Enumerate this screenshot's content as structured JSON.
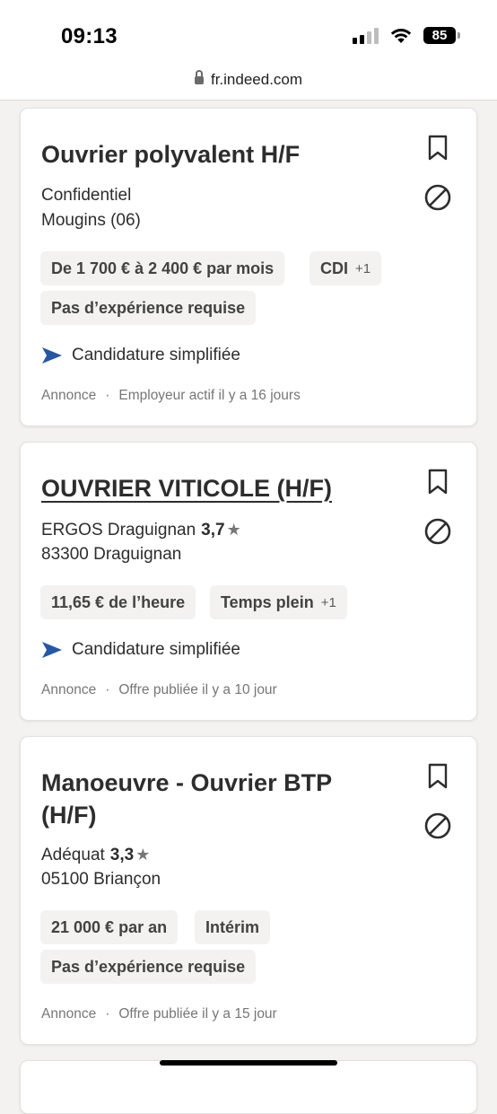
{
  "status_bar": {
    "time": "09:13",
    "battery": "85"
  },
  "browser": {
    "url": "fr.indeed.com"
  },
  "jobs": [
    {
      "title": "Ouvrier polyvalent H/F",
      "company": "Confidentiel",
      "rating": "",
      "location": "Mougins (06)",
      "tags": [
        {
          "label": "De 1 700 € à 2 400 € par mois",
          "extra": ""
        },
        {
          "label": "CDI",
          "extra": "+1"
        },
        {
          "label": "Pas d’expérience requise",
          "extra": ""
        }
      ],
      "apply_label": "Candidature simplifiée",
      "footer_left": "Annonce",
      "footer_sep": "·",
      "footer_right": "Employeur actif il y a 16 jours"
    },
    {
      "title": "OUVRIER VITICOLE (H/F)",
      "company": "ERGOS Draguignan",
      "rating": "3,7",
      "location": "83300 Draguignan",
      "tags": [
        {
          "label": "11,65 € de l’heure",
          "extra": ""
        },
        {
          "label": "Temps plein",
          "extra": "+1"
        }
      ],
      "apply_label": "Candidature simplifiée",
      "footer_left": "Annonce",
      "footer_sep": "·",
      "footer_right": "Offre publiée il y a 10 jour"
    },
    {
      "title": "Manoeuvre - Ouvrier BTP (H/F)",
      "company": "Adéquat",
      "rating": "3,3",
      "location": "05100 Briançon",
      "tags": [
        {
          "label": "21 000 € par an",
          "extra": ""
        },
        {
          "label": "Intérim",
          "extra": ""
        },
        {
          "label": "Pas d’expérience requise",
          "extra": ""
        }
      ],
      "apply_label": "",
      "footer_left": "Annonce",
      "footer_sep": "·",
      "footer_right": "Offre publiée il y a 15 jour"
    }
  ],
  "icons": {
    "bookmark": "bookmark-icon",
    "not_interested": "not-interested-icon",
    "apply": "send-arrow-icon",
    "star": "star-icon"
  },
  "colors": {
    "apply_arrow": "#2557a7",
    "background": "#f3f2f1",
    "tag_bg": "#f3f2f1"
  }
}
